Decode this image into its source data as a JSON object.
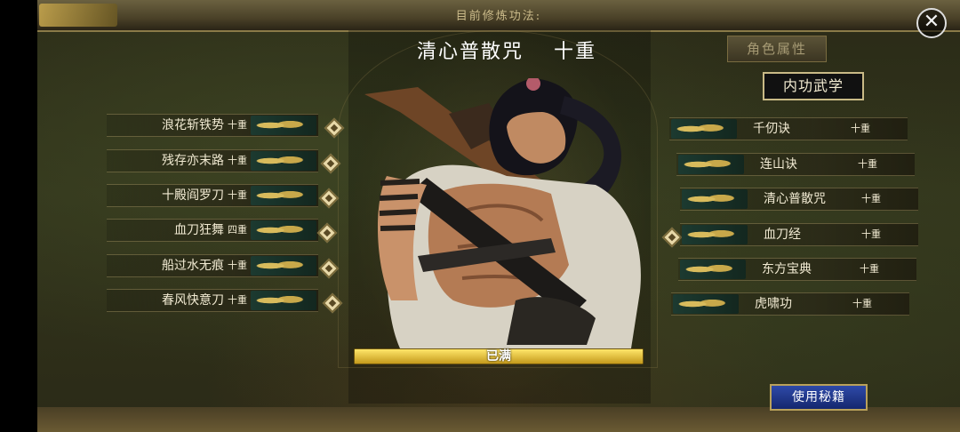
{
  "header": {
    "title": "目前修炼功法:"
  },
  "skill": {
    "name": "清心普散咒",
    "level": "十重"
  },
  "progress": {
    "label": "已满",
    "fraction": 1.0
  },
  "buttons": {
    "role_attr": "角色属性",
    "inner_martial": "内功武学",
    "use_book": "使用秘籍",
    "close": "✕"
  },
  "left_skills": [
    {
      "name": "浪花斩铁势",
      "level": "十重"
    },
    {
      "name": "残存亦末路",
      "level": "十重"
    },
    {
      "name": "十殿阎罗刀",
      "level": "十重"
    },
    {
      "name": "血刀狂舞",
      "level": "四重"
    },
    {
      "name": "船过水无痕",
      "level": "十重"
    },
    {
      "name": "春风快意刀",
      "level": "十重"
    }
  ],
  "right_skills": [
    {
      "name": "千仞诀",
      "level": "十重"
    },
    {
      "name": "连山诀",
      "level": "十重"
    },
    {
      "name": "清心普散咒",
      "level": "十重"
    },
    {
      "name": "血刀经",
      "level": "十重"
    },
    {
      "name": "东方宝典",
      "level": "十重"
    },
    {
      "name": "虎啸功",
      "level": "十重"
    }
  ],
  "colors": {
    "gold": "#c9a84e",
    "button_blue": "#2e4aa8",
    "text": "#f1ead2"
  }
}
